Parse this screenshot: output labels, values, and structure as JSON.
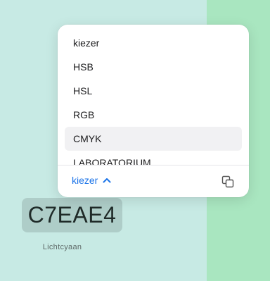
{
  "swatch": {
    "hex": "C7EAE4",
    "name": "Lichtcyaan",
    "main_color": "#c7eae4",
    "side_color": "#a9e6c0"
  },
  "picker": {
    "items": [
      {
        "label": "kiezer"
      },
      {
        "label": "HSB"
      },
      {
        "label": "HSL"
      },
      {
        "label": "RGB"
      },
      {
        "label": "CMYK",
        "selected": true
      },
      {
        "label": "LABORATORIUM"
      }
    ],
    "footer_label": "kiezer",
    "footer_icon": "chevron-up-icon",
    "copy_icon": "copy-icon"
  },
  "colors": {
    "accent": "#1a73e8"
  }
}
